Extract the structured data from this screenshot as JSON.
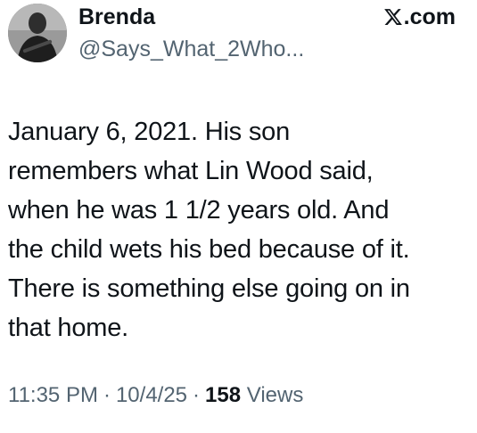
{
  "author": {
    "display_name": "Brenda",
    "handle": "@Says_What_2Who..."
  },
  "brand": {
    "icon": "x-logo-icon",
    "label": ".com"
  },
  "tweet": {
    "text": "January 6, 2021.  His son\nremembers what Lin Wood said,\nwhen he was 1 1/2  years old. And\nthe child wets his bed because of it.\nThere is something else going on in\nthat home."
  },
  "meta": {
    "time": "11:35 PM",
    "separator": "·",
    "date": "10/4/25",
    "views_count": "158",
    "views_label": "Views"
  },
  "colors": {
    "text": "#0f1419",
    "secondary": "#536471",
    "background": "#ffffff"
  }
}
